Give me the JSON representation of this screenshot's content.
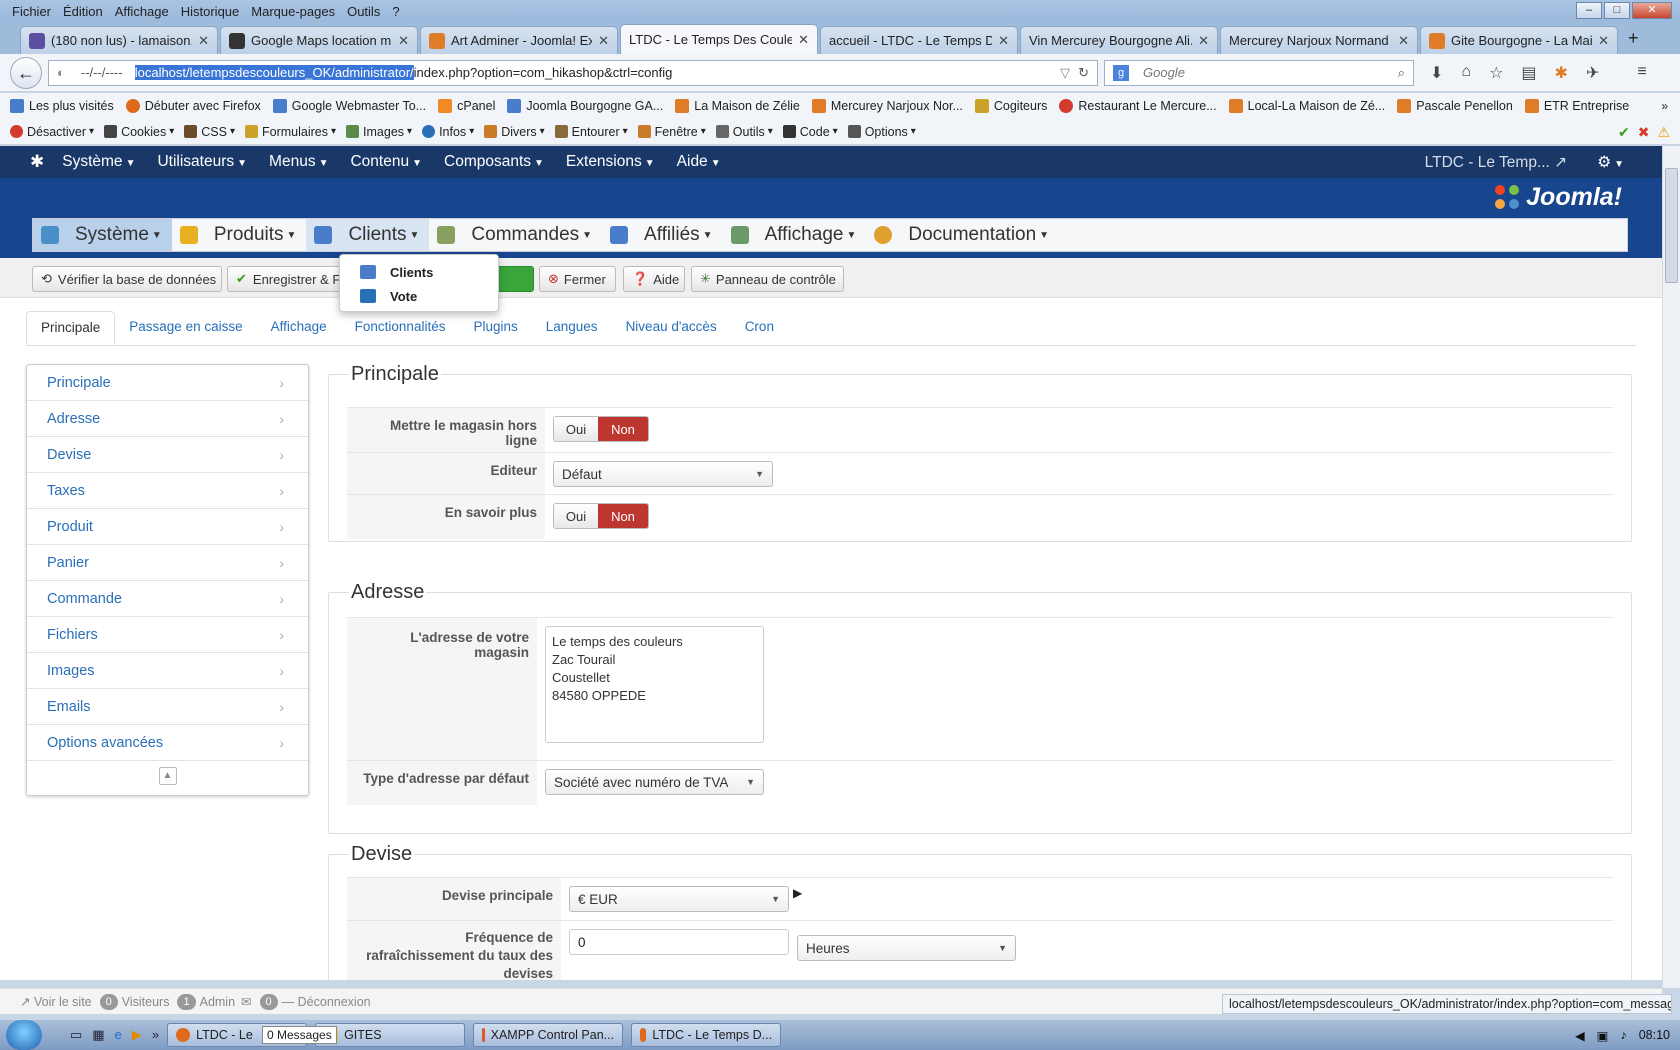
{
  "browser": {
    "menu": [
      "Fichier",
      "Édition",
      "Affichage",
      "Historique",
      "Marque-pages",
      "Outils",
      "?"
    ],
    "tabs": [
      {
        "label": "(180 non lus) - lamaison...",
        "color": "#5a4fa0"
      },
      {
        "label": "Google Maps location m...",
        "color": "#333333"
      },
      {
        "label": "Art Adminer - Joomla! Ex...",
        "color": "#e07b27"
      },
      {
        "label": "LTDC - Le Temps Des Couleu...",
        "color": "#ffffff",
        "active": true
      },
      {
        "label": "accueil - LTDC - Le Temps D...",
        "color": "#ffffff"
      },
      {
        "label": "Vin Mercurey Bourgogne Ali...",
        "color": "#ffffff"
      },
      {
        "label": "Mercurey Narjoux Normand ...",
        "color": "#ffffff"
      },
      {
        "label": "Gite Bourgogne - La Mai...",
        "color": "#e07b27"
      }
    ],
    "url_history_label": "--/--/----",
    "url_selected": "localhost/letempsdescouleurs_OK/administrator/",
    "url_rest": "index.php?option=com_hikashop&ctrl=config",
    "search_engine": "g",
    "search_placeholder": "Google",
    "bookmarks": [
      {
        "label": "Les plus visités",
        "color": "#4a7ccc"
      },
      {
        "label": "Débuter avec Firefox",
        "color": "#e06a1b"
      },
      {
        "label": "Google Webmaster To...",
        "color": "#4a7ccc"
      },
      {
        "label": "cPanel",
        "color": "#f08a24"
      },
      {
        "label": "Joomla Bourgogne GA...",
        "color": "#4a7ccc"
      },
      {
        "label": "La Maison de Zélie",
        "color": "#e07b27"
      },
      {
        "label": "Mercurey Narjoux Nor...",
        "color": "#e07b27"
      },
      {
        "label": "Cogiteurs",
        "color": "#c9a227"
      },
      {
        "label": "Restaurant Le Mercure...",
        "color": "#d33b2f"
      },
      {
        "label": "Local-La Maison de Zé...",
        "color": "#e07b27"
      },
      {
        "label": "Pascale Penellon",
        "color": "#e07b27"
      },
      {
        "label": "ETR Entreprise",
        "color": "#e07b27"
      }
    ],
    "devtools": [
      "Désactiver",
      "Cookies",
      "CSS",
      "Formulaires",
      "Images",
      "Infos",
      "Divers",
      "Entourer",
      "Fenêtre",
      "Outils",
      "Code",
      "Options"
    ]
  },
  "joomla": {
    "topnav": [
      "Système",
      "Utilisateurs",
      "Menus",
      "Contenu",
      "Composants",
      "Extensions",
      "Aide"
    ],
    "site_name": "LTDC - Le Temp...",
    "brand": "Joomla!",
    "brand_color": "#17458e"
  },
  "hikamenu": [
    {
      "label": "Système",
      "color": "#4a90c8"
    },
    {
      "label": "Produits",
      "color": "#e8b020"
    },
    {
      "label": "Clients",
      "color": "#4a7ccc"
    },
    {
      "label": "Commandes",
      "color": "#8aa060"
    },
    {
      "label": "Affiliés",
      "color": "#4a7ccc"
    },
    {
      "label": "Affichage",
      "color": "#6a9a6a"
    },
    {
      "label": "Documentation",
      "color": "#e0a030"
    }
  ],
  "dropdown": [
    "Clients",
    "Vote"
  ],
  "toolbar": {
    "check_db": "Vérifier la base de données",
    "save_close": "Enregistrer & Fe",
    "close": "Fermer",
    "help": "Aide",
    "control_panel": "Panneau de contrôle"
  },
  "subtabs": [
    "Principale",
    "Passage en caisse",
    "Affichage",
    "Fonctionnalités",
    "Plugins",
    "Langues",
    "Niveau d'accès",
    "Cron"
  ],
  "sidenav": [
    "Principale",
    "Adresse",
    "Devise",
    "Taxes",
    "Produit",
    "Panier",
    "Commande",
    "Fichiers",
    "Images",
    "Emails",
    "Options avancées"
  ],
  "sections": {
    "principale": {
      "title": "Principale",
      "offline_label": "Mettre le magasin hors ligne",
      "editor_label": "Editeur",
      "editor_value": "Défaut",
      "more_label": "En savoir plus",
      "yes": "Oui",
      "no": "Non"
    },
    "adresse": {
      "title": "Adresse",
      "store_label": "L'adresse de votre magasin",
      "store_value": "Le temps des couleurs\nZac Tourail\nCoustellet\n84580 OPPEDE",
      "type_label": "Type d'adresse par défaut",
      "type_value": "Société avec numéro de TVA"
    },
    "devise": {
      "title": "Devise",
      "main_label": "Devise principale",
      "main_value": "€ EUR",
      "freq_label": "Fréquence de rafraîchissement du taux des devises",
      "freq_value": "0",
      "freq_unit": "Heures"
    }
  },
  "statusbar": {
    "view_site": "Voir le site",
    "visitors_count": "0",
    "visitors": "Visiteurs",
    "admin_count": "1",
    "admin": "Admin",
    "messages_count": "0",
    "logout": "Déconnexion",
    "link_status": "localhost/letempsdescouleurs_OK/administrator/index.php?option=com_messages"
  },
  "taskbar": {
    "tasks": [
      "LTDC - Le",
      "GITES",
      "XAMPP Control Pan...",
      "LTDC - Le Temps D..."
    ],
    "tooltip": "0 Messages",
    "clock": "08:10"
  }
}
